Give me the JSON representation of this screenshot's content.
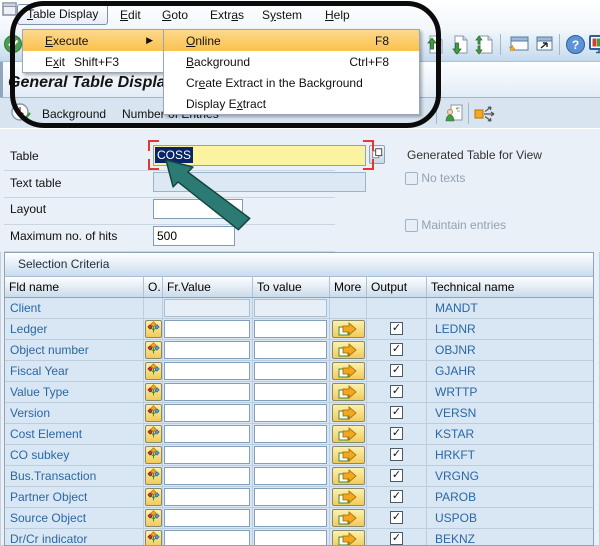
{
  "title": "General Table Display",
  "menu_bar": {
    "items": [
      {
        "pre": "",
        "mn": "T",
        "post": "able Display"
      },
      {
        "pre": "",
        "mn": "E",
        "post": "dit"
      },
      {
        "pre": "",
        "mn": "G",
        "post": "oto"
      },
      {
        "pre": "Extr",
        "mn": "a",
        "post": "s"
      },
      {
        "pre": "S",
        "mn": "y",
        "post": "stem"
      },
      {
        "pre": "",
        "mn": "H",
        "post": "elp"
      }
    ]
  },
  "dropdown_menu": {
    "items": [
      {
        "pre": "",
        "mn": "E",
        "post": "xecute",
        "shortcut": "",
        "highlighted": true,
        "has_submenu": true
      },
      {
        "pre": "E",
        "mn": "x",
        "post": "it",
        "shortcut": "Shift+F3",
        "highlighted": false,
        "has_submenu": false
      }
    ]
  },
  "submenu": {
    "items": [
      {
        "pre": "",
        "mn": "O",
        "post": "nline",
        "shortcut": "F8",
        "highlighted": true
      },
      {
        "pre": "",
        "mn": "B",
        "post": "ackground",
        "shortcut": "Ctrl+F8",
        "highlighted": false
      },
      {
        "pre": "Cr",
        "mn": "e",
        "post": "ate Extract in the Background",
        "shortcut": "",
        "highlighted": false
      },
      {
        "pre": "Display E",
        "mn": "x",
        "post": "tract",
        "shortcut": "",
        "highlighted": false
      }
    ]
  },
  "app_toolbar": {
    "buttons": [
      {
        "label": "Background"
      },
      {
        "label": "Number of Entries"
      }
    ]
  },
  "form": {
    "table": {
      "label": "Table",
      "value": "COSS"
    },
    "text_table": {
      "label": "Text table",
      "value": ""
    },
    "layout": {
      "label": "Layout",
      "value": ""
    },
    "max_hits": {
      "label": "Maximum no. of hits",
      "value": "500"
    },
    "generated_label": "Generated Table for View",
    "no_texts": {
      "label": "No texts",
      "checked": false
    },
    "maintain_entries": {
      "label": "Maintain entries",
      "checked": false
    }
  },
  "selection": {
    "title": "Selection Criteria",
    "columns": [
      "Fld name",
      "O.",
      "Fr.Value",
      "To value",
      "More",
      "Output",
      "Technical name"
    ],
    "check_glyph": "✓",
    "rows": [
      {
        "fld": "Client",
        "tech": "MANDT",
        "has_controls": false,
        "output_checked": false
      },
      {
        "fld": "Ledger",
        "tech": "LEDNR",
        "has_controls": true,
        "output_checked": true
      },
      {
        "fld": "Object number",
        "tech": "OBJNR",
        "has_controls": true,
        "output_checked": true
      },
      {
        "fld": "Fiscal Year",
        "tech": "GJAHR",
        "has_controls": true,
        "output_checked": true
      },
      {
        "fld": "Value Type",
        "tech": "WRTTP",
        "has_controls": true,
        "output_checked": true
      },
      {
        "fld": "Version",
        "tech": "VERSN",
        "has_controls": true,
        "output_checked": true
      },
      {
        "fld": "Cost Element",
        "tech": "KSTAR",
        "has_controls": true,
        "output_checked": true
      },
      {
        "fld": "CO subkey",
        "tech": "HRKFT",
        "has_controls": true,
        "output_checked": true
      },
      {
        "fld": "Bus.Transaction",
        "tech": "VRGNG",
        "has_controls": true,
        "output_checked": true
      },
      {
        "fld": "Partner Object",
        "tech": "PAROB",
        "has_controls": true,
        "output_checked": true
      },
      {
        "fld": "Source Object",
        "tech": "USPOB",
        "has_controls": true,
        "output_checked": true
      },
      {
        "fld": "Dr/Cr indicator",
        "tech": "BEKNZ",
        "has_controls": true,
        "output_checked": true
      }
    ]
  },
  "icons": {
    "window-icon": "window-outline",
    "enter-check-icon": "green-circle-check",
    "export-up-icon": "page-green-up-arrow",
    "import-down-icon": "page-green-down-arrow",
    "transfer-icon": "page-green-up-down-arrows",
    "new-session-icon": "window-orange-star",
    "shortcut-icon": "window-corner-arrow",
    "help-icon": "blue-circle-question",
    "customize-layout-icon": "color-monitor",
    "execute-clock-icon": "clock-green-check",
    "user-settings-icon": "person-document",
    "distribute-icon": "orange-box-three-arrows",
    "selection-options-icon": "three-diamonds",
    "multiple-selection-icon": "orange-arrow-page",
    "value-help-icon": "overlapping-squares",
    "submenu-arrow-icon": "▶",
    "output-check-icon": "✓"
  },
  "colors": {
    "menu_highlight": "#FBC95F",
    "field_yellow": "#FAF3A0",
    "selection_navy": "#0A246A",
    "link_blue": "#2A67A5",
    "annotation_teal": "#2C7A74",
    "bracket_red": "#E5372B",
    "callout_black": "#0B0B0B"
  }
}
